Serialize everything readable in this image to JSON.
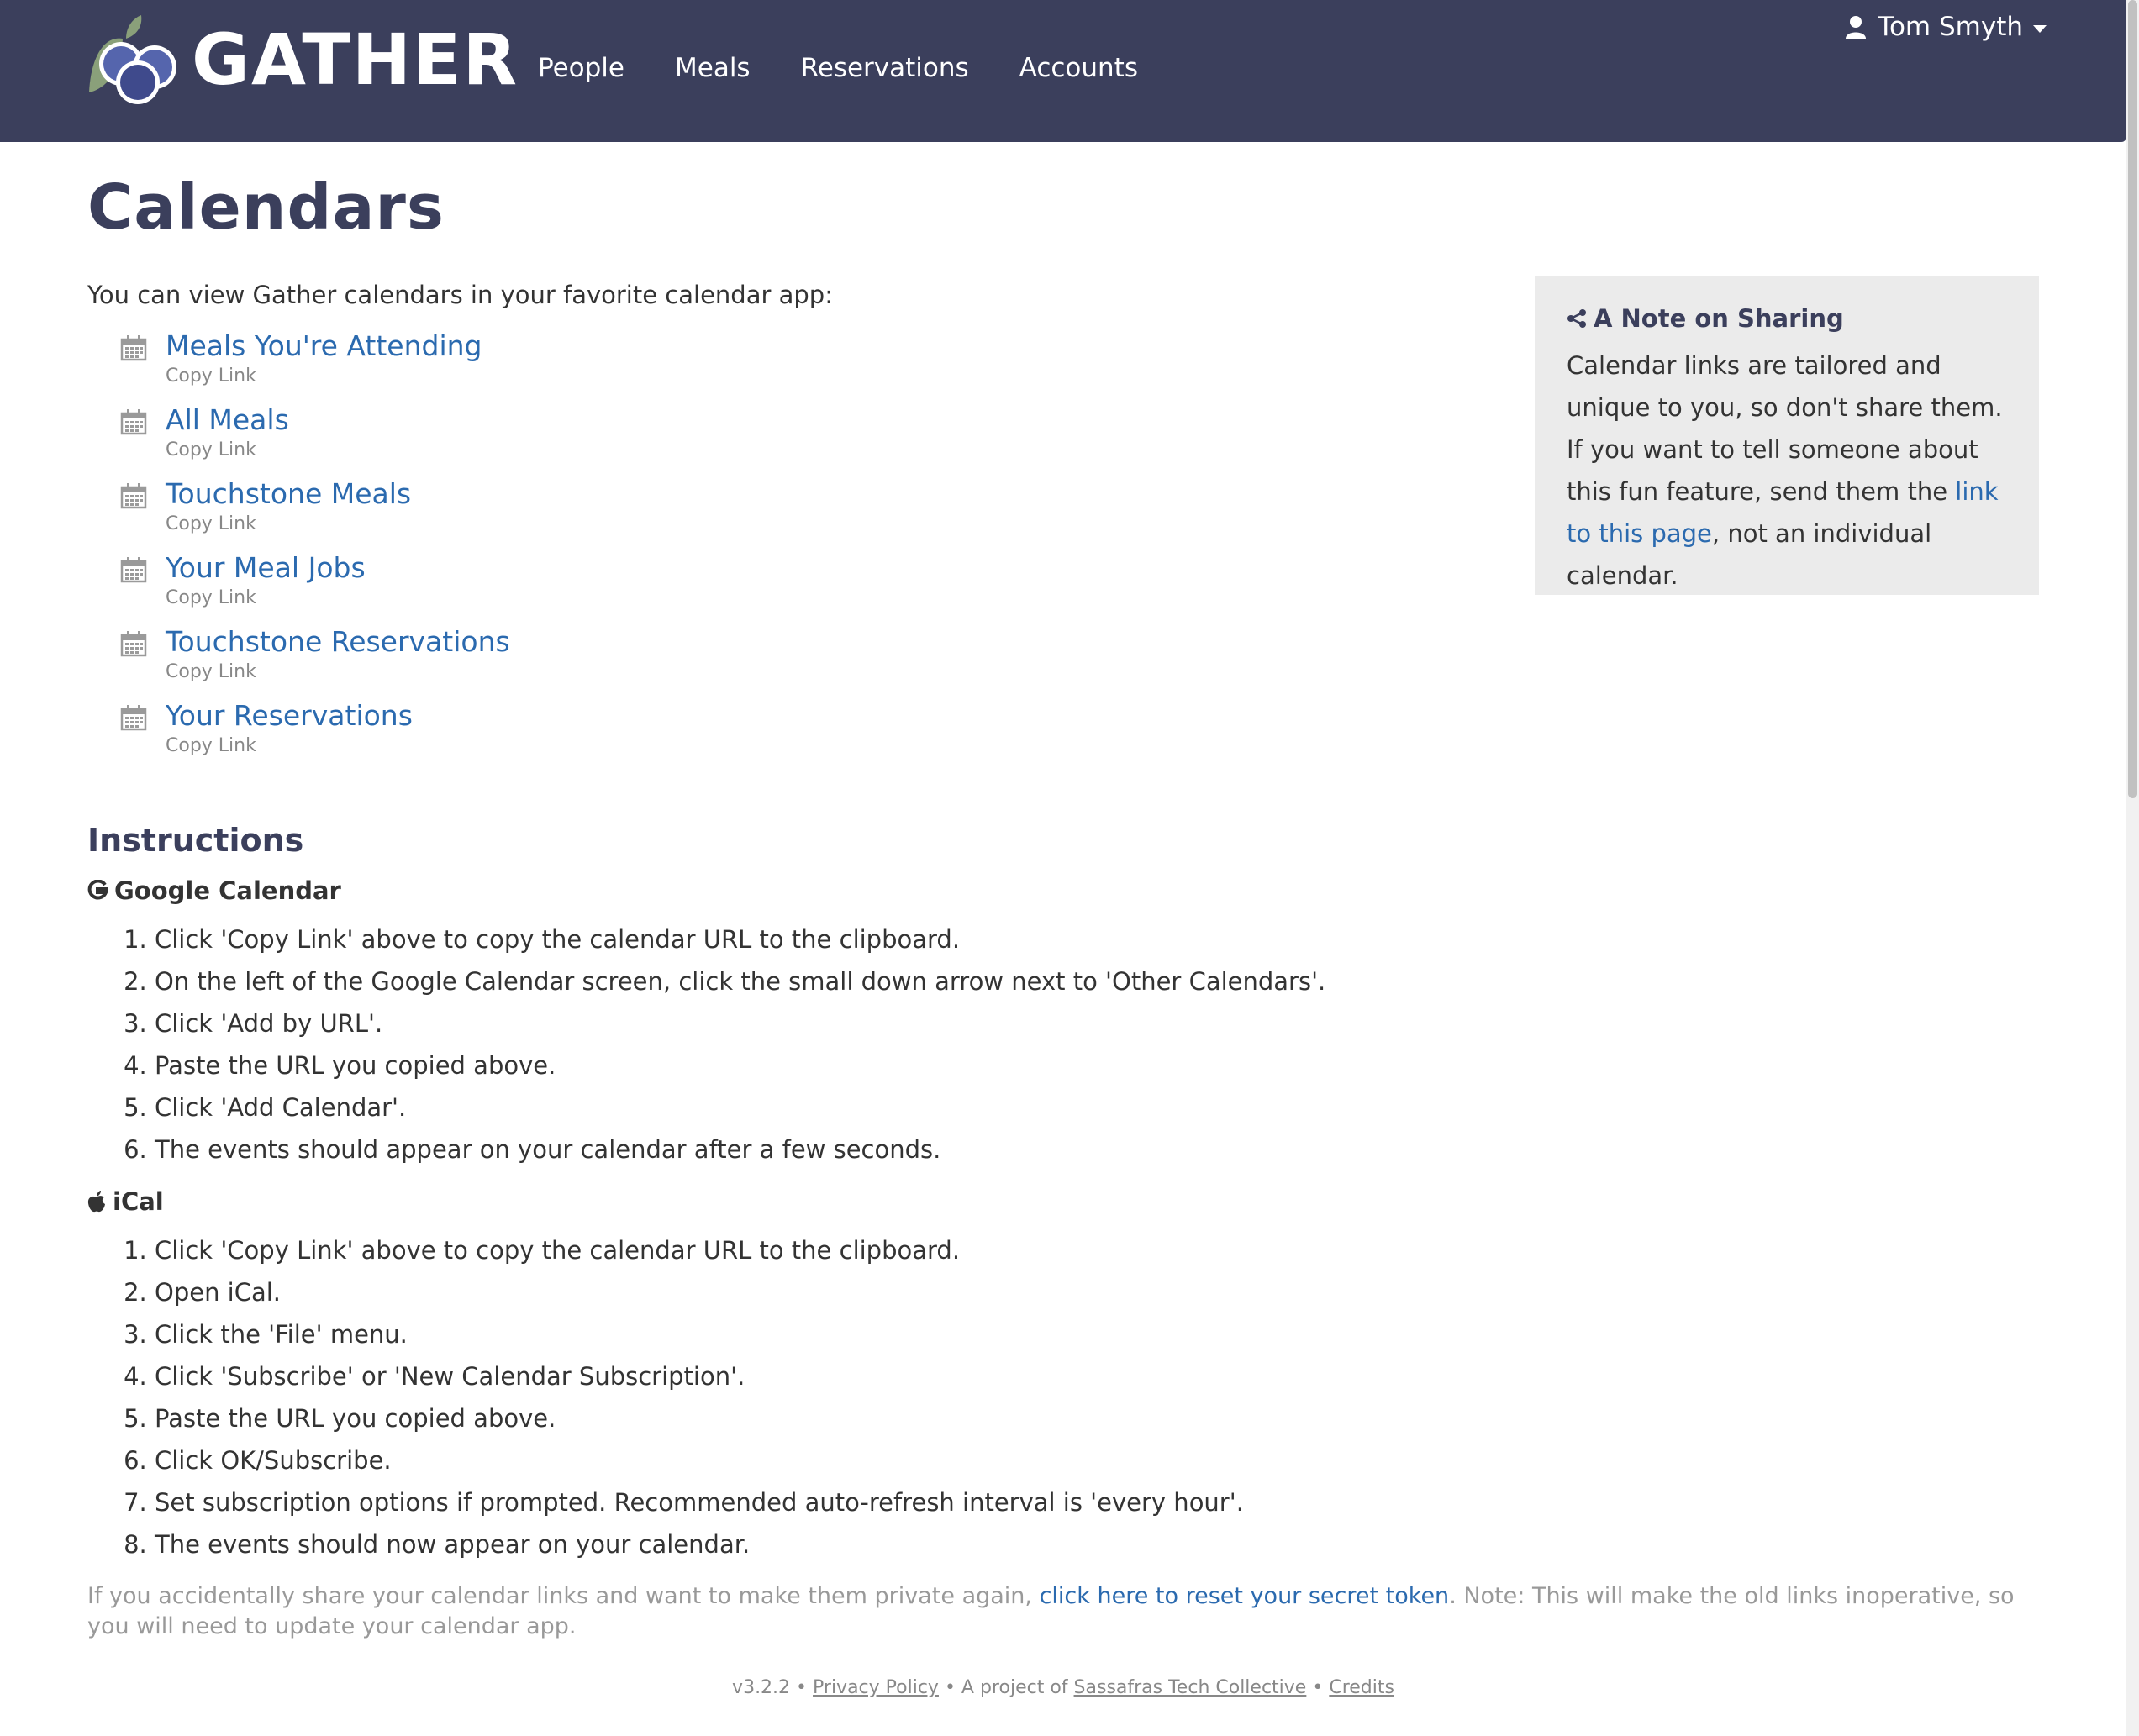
{
  "header": {
    "brand": "GATHER",
    "nav": [
      "People",
      "Meals",
      "Reservations",
      "Accounts"
    ],
    "user_name": "Tom Smyth"
  },
  "page": {
    "title": "Calendars",
    "intro": "You can view Gather calendars in your favorite calendar app:",
    "copy_link_label": "Copy Link",
    "calendars": [
      "Meals You're Attending",
      "All Meals",
      "Touchstone Meals",
      "Your Meal Jobs",
      "Touchstone Reservations",
      "Your Reservations"
    ]
  },
  "note": {
    "title": "A Note on Sharing",
    "body_before": "Calendar links are tailored and unique to you, so don't share them. If you want to tell someone about this fun feature, send them the ",
    "link": "link to this page",
    "body_after": ", not an individual calendar."
  },
  "instructions": {
    "heading": "Instructions",
    "google": {
      "title": "Google Calendar",
      "steps": [
        "Click 'Copy Link' above to copy the calendar URL to the clipboard.",
        "On the left of the Google Calendar screen, click the small down arrow next to 'Other Calendars'.",
        "Click 'Add by URL'.",
        "Paste the URL you copied above.",
        "Click 'Add Calendar'.",
        "The events should appear on your calendar after a few seconds."
      ]
    },
    "ical": {
      "title": "iCal",
      "steps": [
        "Click 'Copy Link' above to copy the calendar URL to the clipboard.",
        "Open iCal.",
        "Click the 'File' menu.",
        "Click 'Subscribe' or 'New Calendar Subscription'.",
        "Paste the URL you copied above.",
        "Click OK/Subscribe.",
        "Set subscription options if prompted. Recommended auto-refresh interval is 'every hour'.",
        "The events should now appear on your calendar."
      ]
    }
  },
  "reset": {
    "before": "If you accidentally share your calendar links and want to make them private again, ",
    "link": "click here to reset your secret token",
    "after": ". Note: This will make the old links inoperative, so you will need to update your calendar app."
  },
  "footer": {
    "version": "v3.2.2",
    "privacy": "Privacy Policy",
    "project_prefix": "A project of",
    "org": "Sassafras Tech Collective",
    "credits": "Credits"
  },
  "colors": {
    "navbar": "#3b3f5c",
    "link": "#2b6aaf",
    "note_bg": "#ebebeb"
  }
}
